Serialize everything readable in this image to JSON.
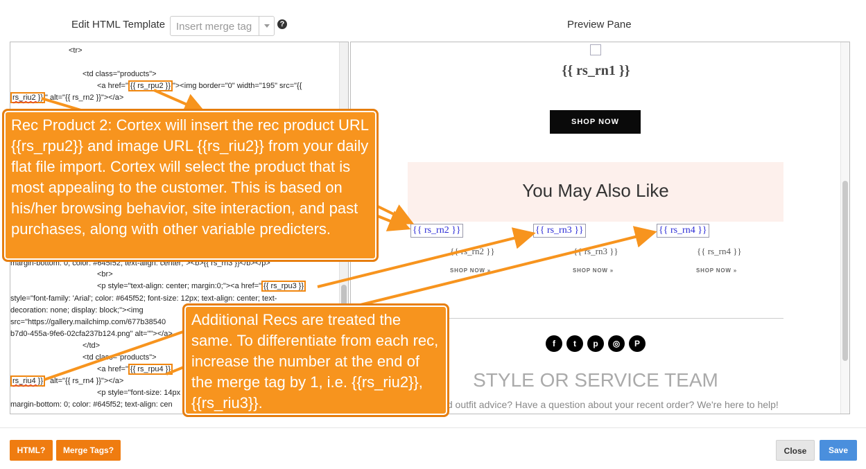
{
  "header": {
    "edit_label": "Edit HTML Template",
    "merge_placeholder": "Insert merge tag",
    "help_glyph": "?",
    "preview_label": "Preview Pane"
  },
  "code": {
    "l1": "<tr>",
    "l2": "<td class=\"products\">",
    "l3a": "<a href=\"",
    "l3b": "{{ rs_rpu2 }}",
    "l3c": "\"><img border=\"0\" width=\"195\" src=\"{{",
    "l4a": "rs_riu2 }}",
    "l4b": "\" alt=\"{{ rs_rn2 }}\"></a>",
    "l5": "margin-bottom: 0; color: #645f52; text-align: center;\"><b>{{ rs_rn3 }}</b></p>",
    "l6": "<br>",
    "l7a": "<p style=\"text-align: center; margin:0;\"><a href=\"",
    "l7b": "{{ rs_rpu3 }}",
    "l8": "style=\"font-family: 'Arial'; color: #645f52; font-size: 12px; text-align: center; text-",
    "l9": "decoration: none; display: block;\"><img",
    "l10": "src=\"https://gallery.mailchimp.com/677b38540",
    "l11": "b7d0-455a-9fe6-02cfa237b124.png\" alt=\"\"></a>",
    "l12": "</td>",
    "l13": "<td class=\"products\">",
    "l14a": "<a href=\"",
    "l14b": "{{ rs_rpu4 }}",
    "l15a": "rs_riu4 }}",
    "l15b": "\" alt=\"{{ rs_rn4 }}\"></a>",
    "l16": "<p style=\"font-size: 14px",
    "l17": "margin-bottom: 0; color: #645f52; text-align: cen"
  },
  "preview": {
    "rn1": "{{ rs_rn1 }}",
    "shop_now": "SHOP NOW",
    "also_like": "You May Also Like",
    "recs": [
      {
        "img_alt": "{{ rs_rn2 }}",
        "name": "{{ rs_rn2 }}",
        "shop": "SHOP NOW »"
      },
      {
        "img_alt": "{{ rs_rn3 }}",
        "name": "{{ rs_rn3 }}",
        "shop": "SHOP NOW »"
      },
      {
        "img_alt": "{{ rs_rn4 }}",
        "name": "{{ rs_rn4 }}",
        "shop": "SHOP NOW »"
      }
    ],
    "socials": [
      "f",
      "t",
      "p",
      "◎",
      "P"
    ],
    "team_title": "STYLE OR SERVICE TEAM",
    "team_sub": "Need outfit advice? Have a question about your recent order? We're here to help!"
  },
  "callouts": {
    "rec2": "Rec Product 2: Cortex will insert the rec product URL {{rs_rpu2}} and image URL {{rs_riu2}} from your daily flat file import. Cortex will select the product that is most appealing to the customer. This is based on his/her browsing behavior, site interaction, and past purchases, along with other variable predicters.",
    "additional": "Additional Recs are treated the same. To differentiate from each rec, increase the number at the end of the merge tag by 1, i.e. {{rs_riu2}}, {{rs_riu3}}."
  },
  "buttons": {
    "html": "HTML?",
    "merge_tags": "Merge Tags?",
    "close": "Close",
    "save": "Save"
  },
  "colors": {
    "callout": "#f7941e",
    "orange_button": "#ef7c10",
    "save_button": "#4a8fdd"
  }
}
